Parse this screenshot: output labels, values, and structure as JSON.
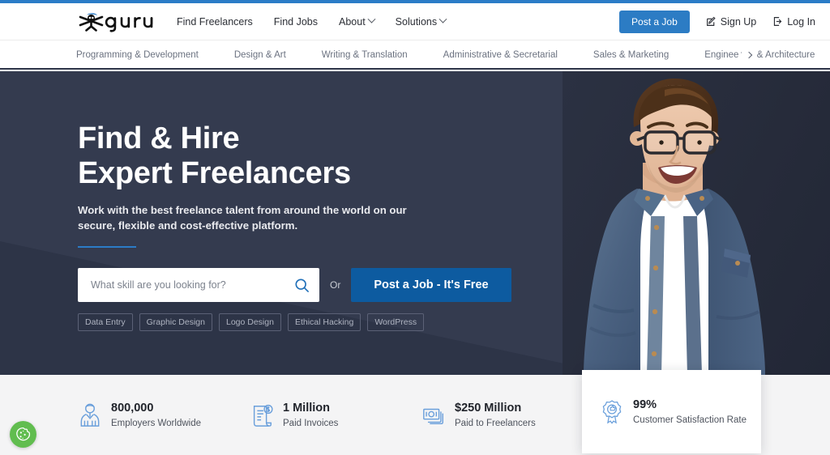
{
  "brand": {
    "name": "guru",
    "logo_icon": "guru-person-logo-icon",
    "accent_blue": "#2b7cc7",
    "cta_blue": "#0d5ba0",
    "hero_bg": "#343b4f",
    "stats_bg": "#f4f4f5",
    "cookie_green": "#61bd4f"
  },
  "header": {
    "nav": [
      {
        "label": "Find Freelancers",
        "has_caret": false
      },
      {
        "label": "Find Jobs",
        "has_caret": false
      },
      {
        "label": "About",
        "has_caret": true
      },
      {
        "label": "Solutions",
        "has_caret": true
      }
    ],
    "post_job_label": "Post a Job",
    "sign_up_label": "Sign Up",
    "log_in_label": "Log In",
    "sign_up_icon": "pencil-square-icon",
    "log_in_icon": "login-arrow-icon"
  },
  "categories": {
    "items": [
      "Programming & Development",
      "Design & Art",
      "Writing & Translation",
      "Administrative & Secretarial",
      "Sales & Marketing",
      "Engineering & Architecture"
    ],
    "next_icon": "chevron-right-icon"
  },
  "hero": {
    "heading_line1": "Find & Hire",
    "heading_line2": "Expert Freelancers",
    "subtitle": "Work with the best freelance talent from around the world on our secure, flexible and cost-effective platform.",
    "search": {
      "placeholder": "What skill are you looking for?",
      "value": "",
      "icon": "search-icon"
    },
    "or_label": "Or",
    "cta_label": "Post a Job - It's Free",
    "tags": [
      "Data Entry",
      "Graphic Design",
      "Logo Design",
      "Ethical Hacking",
      "WordPress"
    ],
    "photo_alt": "smiling-man-with-glasses-in-denim-shirt"
  },
  "stats": [
    {
      "icon": "employer-person-icon",
      "value": "800,000",
      "label": "Employers Worldwide",
      "highlighted": false
    },
    {
      "icon": "invoice-dollar-icon",
      "value": "1 Million",
      "label": "Paid Invoices",
      "highlighted": false
    },
    {
      "icon": "cash-stack-icon",
      "value": "$250 Million",
      "label": "Paid to Freelancers",
      "highlighted": false
    },
    {
      "icon": "award-ribbon-thumbsup-icon",
      "value": "99%",
      "label": "Customer Satisfaction Rate",
      "highlighted": true
    }
  ],
  "cookie_widget": {
    "icon": "cookie-icon",
    "label": "Cookie settings"
  }
}
